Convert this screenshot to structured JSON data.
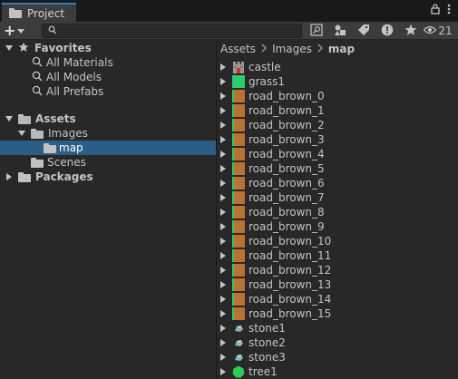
{
  "window": {
    "tab_label": "Project",
    "tab_icon": "folder-icon",
    "visibility_count": "21"
  },
  "toolbar": {
    "add_label": "+",
    "search_placeholder": ""
  },
  "tree": {
    "favorites_label": "Favorites",
    "favorites_items": [
      {
        "label": "All Materials"
      },
      {
        "label": "All Models"
      },
      {
        "label": "All Prefabs"
      }
    ],
    "assets_label": "Assets",
    "images_label": "Images",
    "map_label": "map",
    "scenes_label": "Scenes",
    "packages_label": "Packages"
  },
  "breadcrumb": [
    "Assets",
    "Images",
    "map"
  ],
  "assets": [
    {
      "name": "castle",
      "kind": "castle"
    },
    {
      "name": "grass1",
      "kind": "grass"
    },
    {
      "name": "road_brown_0",
      "kind": "road"
    },
    {
      "name": "road_brown_1",
      "kind": "road"
    },
    {
      "name": "road_brown_2",
      "kind": "road"
    },
    {
      "name": "road_brown_3",
      "kind": "road-corner"
    },
    {
      "name": "road_brown_4",
      "kind": "road-corner"
    },
    {
      "name": "road_brown_5",
      "kind": "road-corner"
    },
    {
      "name": "road_brown_6",
      "kind": "road-corner"
    },
    {
      "name": "road_brown_7",
      "kind": "road"
    },
    {
      "name": "road_brown_8",
      "kind": "road"
    },
    {
      "name": "road_brown_9",
      "kind": "road"
    },
    {
      "name": "road_brown_10",
      "kind": "road"
    },
    {
      "name": "road_brown_11",
      "kind": "road"
    },
    {
      "name": "road_brown_12",
      "kind": "road"
    },
    {
      "name": "road_brown_13",
      "kind": "road"
    },
    {
      "name": "road_brown_14",
      "kind": "road"
    },
    {
      "name": "road_brown_15",
      "kind": "road"
    },
    {
      "name": "stone1",
      "kind": "stone"
    },
    {
      "name": "stone2",
      "kind": "stone"
    },
    {
      "name": "stone3",
      "kind": "stone"
    },
    {
      "name": "tree1",
      "kind": "tree"
    }
  ],
  "colors": {
    "selection": "#2c5d87",
    "tab_accent": "#3a79bb",
    "grass": "#2ecc71",
    "road": "#b87333",
    "stone": "#8fb0b8",
    "tree": "#2ecc55"
  }
}
